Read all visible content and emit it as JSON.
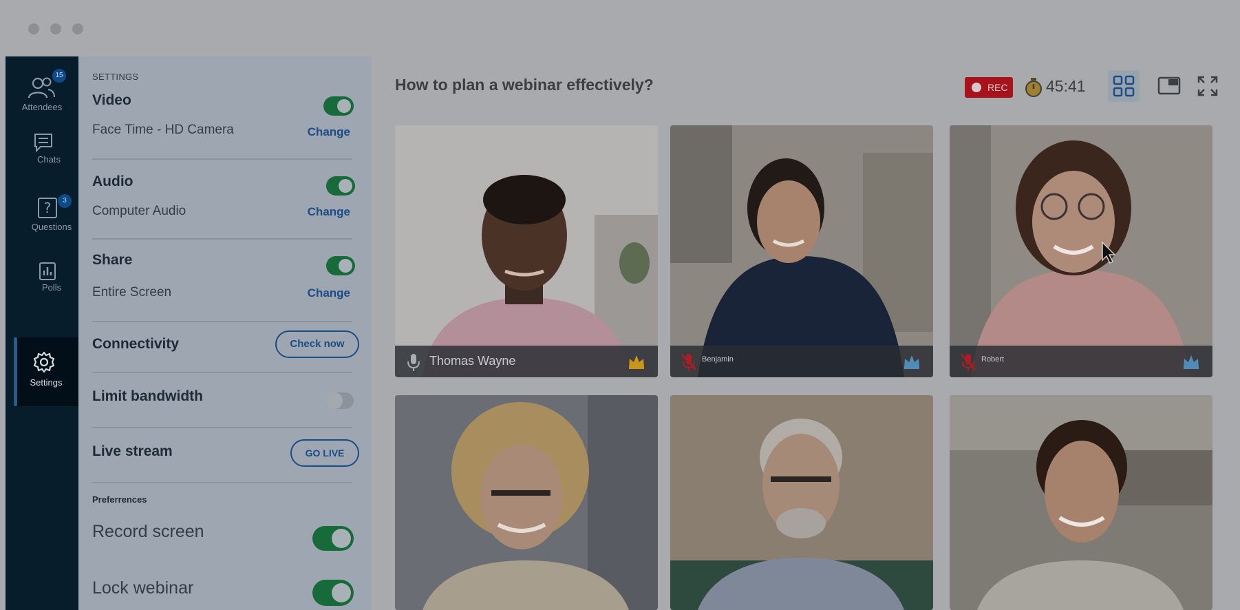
{
  "nav": {
    "attendees": {
      "label": "Attendees",
      "badge": "15"
    },
    "chats": {
      "label": "Chats"
    },
    "questions": {
      "label": "Questions",
      "badge": "3"
    },
    "polls": {
      "label": "Polls"
    },
    "settings": {
      "label": "Settings"
    }
  },
  "settings": {
    "heading": "SETTINGS",
    "video": {
      "title": "Video",
      "device": "Face Time - HD Camera",
      "change_label": "Change",
      "enabled": true
    },
    "audio": {
      "title": "Audio",
      "device": "Computer Audio",
      "change_label": "Change",
      "enabled": true
    },
    "share": {
      "title": "Share",
      "device": "Entire Screen",
      "change_label": "Change",
      "enabled": true
    },
    "connectivity": {
      "title": "Connectivity",
      "button_label": "Check now"
    },
    "limit_bandwidth": {
      "title": "Limit bandwidth",
      "enabled": false
    },
    "live_stream": {
      "title": "Live stream",
      "button_label": "GO LIVE"
    },
    "preferences": {
      "heading": "Preferrences",
      "record_screen": {
        "label": "Record screen",
        "enabled": true
      },
      "lock_webinar": {
        "label": "Lock webinar",
        "enabled": true
      }
    }
  },
  "main": {
    "title": "How to plan a webinar effectively?",
    "rec_label": "REC",
    "timer": "45:41",
    "participants": [
      {
        "name": "Thomas Wayne",
        "muted": false,
        "host": true
      },
      {
        "name": "Benjamin",
        "muted": true,
        "host": false
      },
      {
        "name": "Robert",
        "muted": true,
        "host": false
      },
      {
        "name": "",
        "muted": false,
        "host": false
      },
      {
        "name": "",
        "muted": false,
        "host": false
      },
      {
        "name": "",
        "muted": false,
        "host": false
      }
    ]
  },
  "colors": {
    "nav_bg": "#071d2b",
    "accent_blue": "#1a4c86",
    "toggle_on": "#176a3a",
    "rec_red": "#a8121a",
    "crown_gold": "#d4a017",
    "crown_blue": "#5ea8d8",
    "muted_red": "#b21a22"
  },
  "icons": [
    "people-icon",
    "chat-icon",
    "question-icon",
    "poll-icon",
    "gear-icon",
    "stopwatch-icon",
    "grid-view-icon",
    "picture-in-picture-icon",
    "fullscreen-icon",
    "microphone-icon",
    "microphone-muted-icon",
    "crown-icon"
  ]
}
